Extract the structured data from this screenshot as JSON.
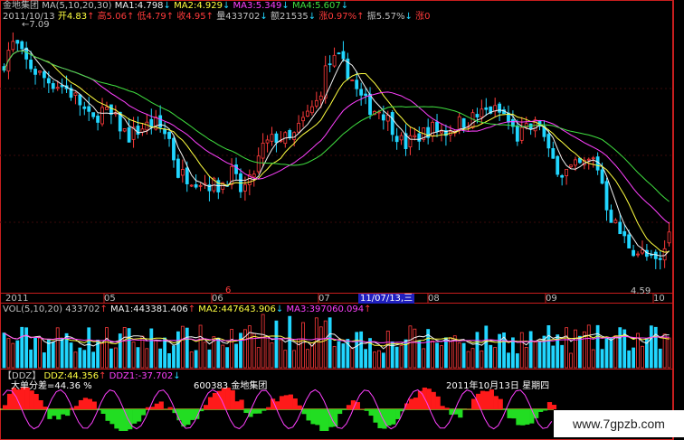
{
  "colors": {
    "up": "#ff3b3b",
    "down": "#21d6ff",
    "ma1": "#f2f2f2",
    "ma2": "#ffff40",
    "ma3": "#ff40ff",
    "ma4": "#40e040",
    "axis": "#c81e1e",
    "label": "#c0c0c0",
    "ddz_red": "#ff1a1a",
    "ddz_green": "#22dd22",
    "ddz_line": "#ff40ff"
  },
  "header": {
    "stock": "金地集团",
    "ma_spec": "MA(5,10,20,30)",
    "ma1": "MA1:4.798",
    "ma1_arrow": "↓",
    "ma2": "MA2:4.929",
    "ma2_arrow": "↓",
    "ma3": "MA3:5.349",
    "ma3_arrow": "↓",
    "ma4": "MA4:5.607",
    "ma4_arrow": "↓",
    "date": "2011/10/13",
    "open": "开4.83",
    "open_arrow": "↑",
    "high": "高5.06",
    "high_arrow": "↑",
    "low": "低4.79",
    "low_arrow": "↑",
    "close": "收4.95",
    "close_arrow": "↑",
    "volume": "量433702",
    "volume_arrow": "↓",
    "amount": "额21535",
    "amount_arrow": "↓",
    "change": "涨0.97%",
    "change_arrow": "↑",
    "swing": "振5.57%",
    "swing_arrow": "↓",
    "rise_label": "涨",
    "rise_value": "0"
  },
  "price_labels": {
    "high": "7.09",
    "low": "4.59"
  },
  "x_axis": {
    "labels": [
      "2011",
      "05",
      "06",
      "07",
      "08",
      "09",
      "10"
    ],
    "marker": "6",
    "cursor_date": "11/07/13,三"
  },
  "vol_header": {
    "spec": "VOL(5,10,20)",
    "value": "433702",
    "value_arrow": "↑",
    "ma1": "MA1:443381.406",
    "ma1_arrow": "↑",
    "ma2": "MA2:447643.906",
    "ma2_arrow": "↓",
    "ma3": "MA3:397060.094",
    "ma3_arrow": "↑"
  },
  "ddz_header": {
    "name": "【DDZ】",
    "ddz": "DDZ:44.356",
    "ddz_arrow": "↑",
    "ddz1": "DDZ1:-37.702",
    "ddz1_arrow": "↓",
    "big_diff": "大单分差=44.36 %",
    "code": "600383",
    "stock": "金地集团",
    "date": "2011年10月13日",
    "weekday": "星期四"
  },
  "watermark": "www.7gpzb.com",
  "chart_data": [
    {
      "type": "candlestick",
      "title": "金地集团",
      "x": [
        "2011-01",
        "2011-05",
        "2011-06",
        "2011-07",
        "2011-08",
        "2011-09",
        "2011-10"
      ],
      "price_range": [
        4.59,
        7.09
      ],
      "series": [
        {
          "name": "MA1",
          "value": 4.798
        },
        {
          "name": "MA2",
          "value": 4.929
        },
        {
          "name": "MA3",
          "value": 5.349
        },
        {
          "name": "MA4",
          "value": 5.607
        }
      ],
      "last_bar": {
        "date": "2011-10-13",
        "open": 4.83,
        "high": 5.06,
        "low": 4.79,
        "close": 4.95
      }
    },
    {
      "type": "bar",
      "title": "VOL(5,10,20)",
      "series": [
        {
          "name": "VOL",
          "value": 433702
        },
        {
          "name": "MA1",
          "value": 443381.406
        },
        {
          "name": "MA2",
          "value": 447643.906
        },
        {
          "name": "MA3",
          "value": 397060.094
        }
      ]
    },
    {
      "type": "bar",
      "title": "DDZ",
      "series": [
        {
          "name": "DDZ",
          "value": 44.356
        },
        {
          "name": "DDZ1",
          "value": -37.702
        }
      ]
    }
  ]
}
